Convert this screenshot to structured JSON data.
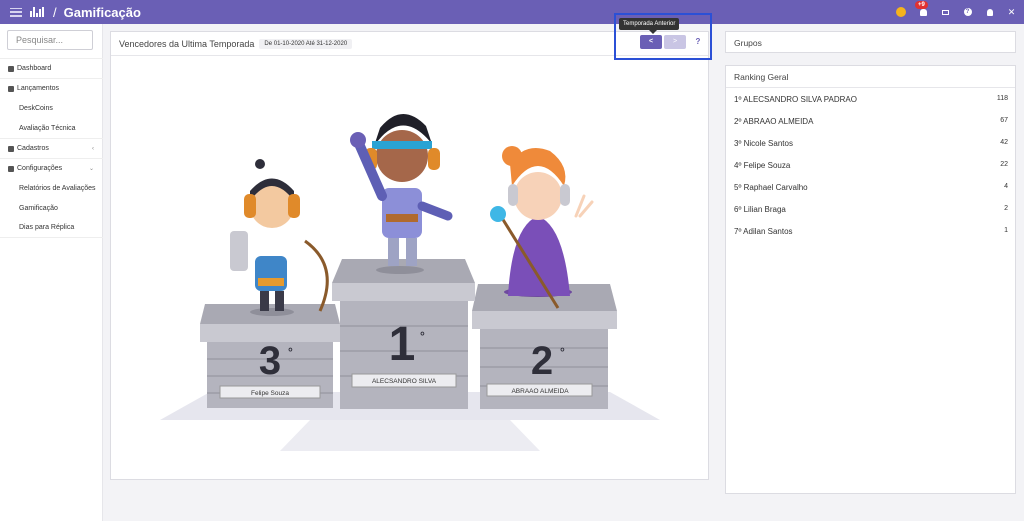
{
  "topbar": {
    "title": "Gamificação",
    "separator": "/",
    "notification_count": "+9",
    "help_glyph": "?",
    "expand_glyph": "✕"
  },
  "sidebar": {
    "search_placeholder": "Pesquisar...",
    "items": [
      {
        "label": "Dashboard",
        "icon": "dashboard-icon"
      },
      {
        "label": "Lançamentos",
        "icon": "send-icon"
      },
      {
        "label": "DeskCoins"
      },
      {
        "label": "Avaliação Técnica"
      },
      {
        "label": "Cadastros",
        "icon": "edit-icon",
        "caret": "‹"
      },
      {
        "label": "Configurações",
        "icon": "gear-icon",
        "caret": "⌄"
      },
      {
        "label": "Relatórios de Avaliações"
      },
      {
        "label": "Gamificação"
      },
      {
        "label": "Dias para Réplica"
      }
    ]
  },
  "main": {
    "title": "Vencedores da Ultima Temporada",
    "date_range": "De 01-10-2020 Até 31-12-2020",
    "tooltip": "Temporada Anterior",
    "prev_label": "<",
    "next_label": ">",
    "help_label": "?",
    "podium": {
      "first": {
        "place": "1",
        "ordinal": "°",
        "name": "ALECSANDRO SILVA"
      },
      "second": {
        "place": "2",
        "ordinal": "°",
        "name": "ABRAAO ALMEIDA"
      },
      "third": {
        "place": "3",
        "ordinal": "°",
        "name": "Felipe Souza"
      }
    }
  },
  "groups": {
    "title": "Grupos"
  },
  "ranking": {
    "title": "Ranking Geral",
    "rows": [
      {
        "name": "1º ALECSANDRO SILVA PADRAO",
        "points": "118"
      },
      {
        "name": "2º ABRAAO ALMEIDA",
        "points": "67"
      },
      {
        "name": "3º Nicole Santos",
        "points": "42"
      },
      {
        "name": "4º Felipe Souza",
        "points": "22"
      },
      {
        "name": "5º Raphael Carvalho",
        "points": "4"
      },
      {
        "name": "6º Lilian Braga",
        "points": "2"
      },
      {
        "name": "7º Adilan Santos",
        "points": "1"
      }
    ]
  },
  "colors": {
    "primary": "#6a5fb5",
    "highlight": "#2b50d6",
    "badge": "#e03232"
  }
}
